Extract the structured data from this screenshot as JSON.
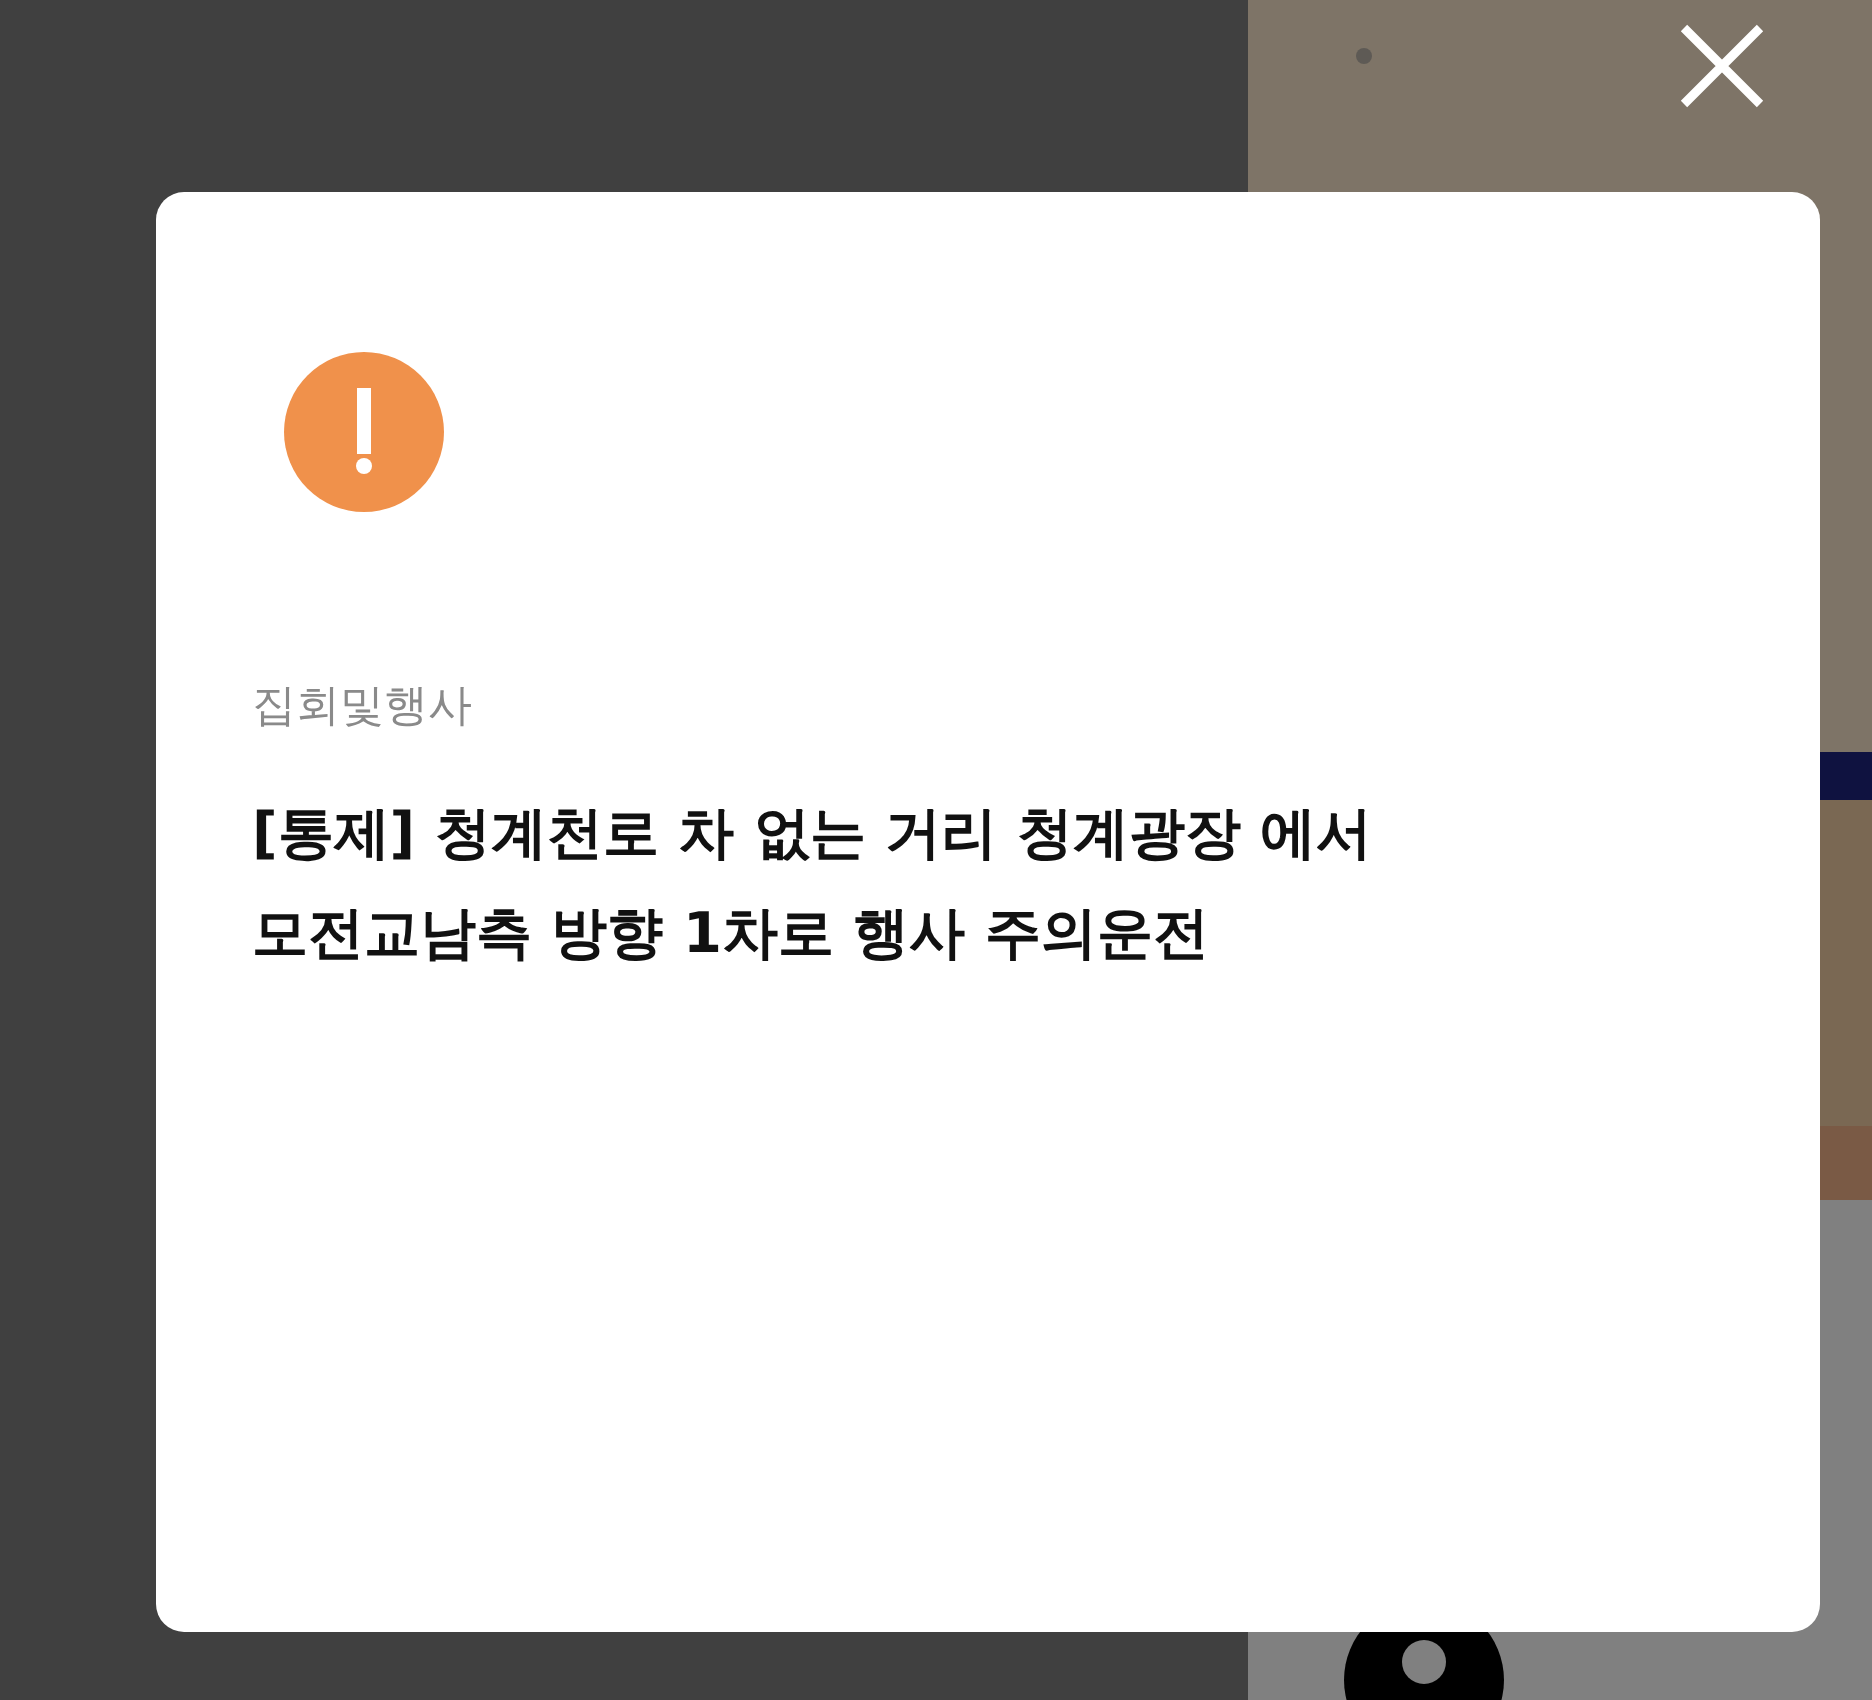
{
  "dialog": {
    "category": "집회및행사",
    "title": "[통제] 청계천로 차 없는 거리 청계광장 에서 모전교남측 방향 1차로 행사 주의운전"
  }
}
